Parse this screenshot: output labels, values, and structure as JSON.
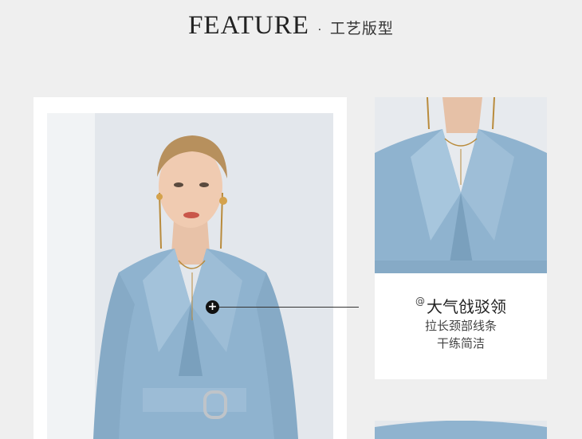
{
  "header": {
    "title": "FEATURE",
    "separator": "·",
    "subtitle": "工艺版型"
  },
  "detail": {
    "at_symbol": "@",
    "title": "大气戗驳领",
    "lines": [
      "拉长颈部线条",
      "干练简洁"
    ]
  },
  "hotspot": {
    "icon": "plus-icon",
    "glyph": "+"
  },
  "colors": {
    "background": "#efefef",
    "blazer": "#8fb3cf",
    "card": "#ffffff"
  }
}
